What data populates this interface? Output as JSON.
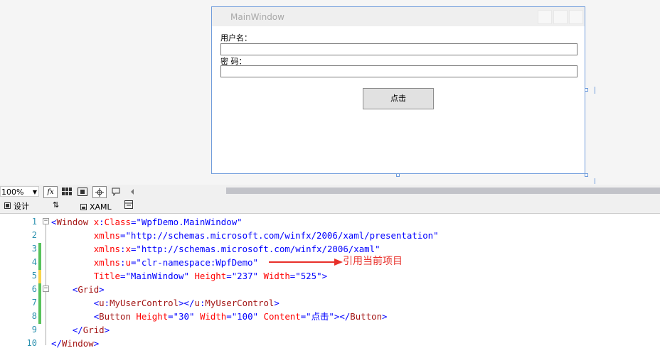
{
  "preview_window": {
    "title": "MainWindow",
    "username_label": "用户名：",
    "password_label": "密 码：",
    "button_label": "点击"
  },
  "toolbar": {
    "zoom": "100%",
    "fx_label": "fx"
  },
  "tabs": {
    "design": "设计",
    "swap": "⇅",
    "xaml": "XAML"
  },
  "editor": {
    "line_numbers": [
      "1",
      "2",
      "3",
      "4",
      "5",
      "6",
      "7",
      "8",
      "9",
      "10"
    ]
  },
  "annotation": {
    "text": "引用当前项目",
    "color": "#e8302a"
  },
  "colors": {
    "accent": "#6f9cdb",
    "change_bar_saved": "#57c15b",
    "change_bar_unsaved": "#f7d44a"
  }
}
